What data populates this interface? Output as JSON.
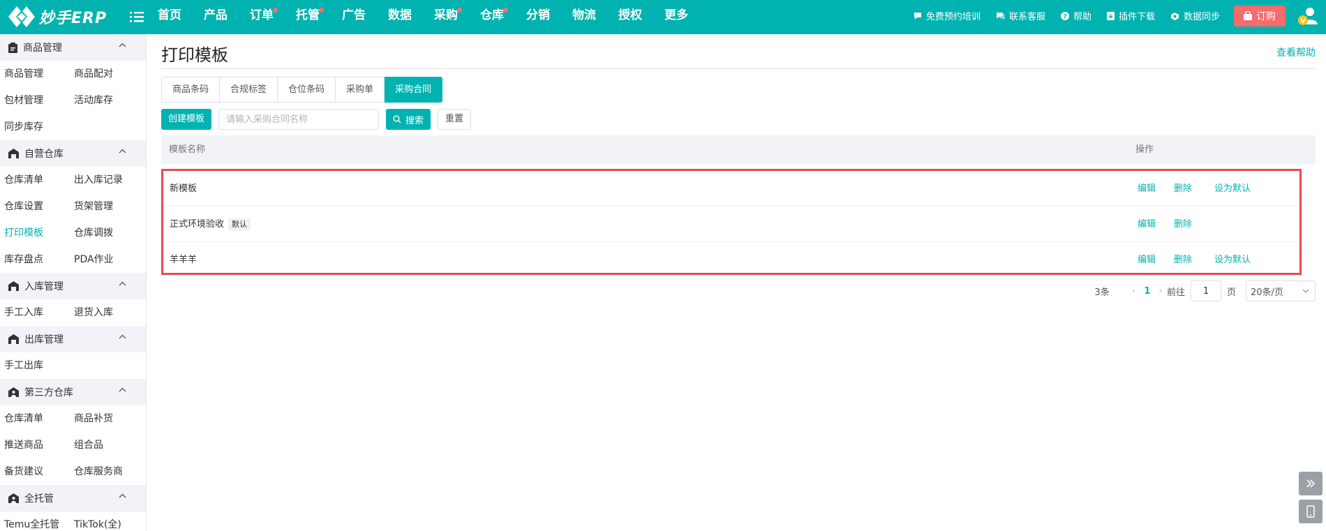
{
  "app": {
    "logo_text": "妙手ERP"
  },
  "nav": {
    "items": [
      {
        "label": "首页",
        "dot": false
      },
      {
        "label": "产品",
        "dot": false
      },
      {
        "label": "订单",
        "dot": true
      },
      {
        "label": "托管",
        "dot": true
      },
      {
        "label": "广告",
        "dot": false
      },
      {
        "label": "数据",
        "dot": false
      },
      {
        "label": "采购",
        "dot": true
      },
      {
        "label": "仓库",
        "dot": true
      },
      {
        "label": "分销",
        "dot": false
      },
      {
        "label": "物流",
        "dot": false
      },
      {
        "label": "授权",
        "dot": false
      },
      {
        "label": "更多",
        "dot": false
      }
    ],
    "tools": {
      "training": "免费预约培训",
      "service": "联系客服",
      "help": "帮助",
      "plugin": "插件下载",
      "sync": "数据同步"
    },
    "subscribe": "订购"
  },
  "sidebar": {
    "groups": [
      {
        "title": "商品管理",
        "icon": "clipboard-icon",
        "links": [
          "商品管理",
          "商品配对",
          "包材管理",
          "活动库存",
          "同步库存"
        ]
      },
      {
        "title": "自营仓库",
        "icon": "warehouse-icon",
        "links": [
          "仓库清单",
          "出入库记录",
          "仓库设置",
          "货架管理",
          "打印模板",
          "仓库调拨",
          "库存盘点",
          "PDA作业"
        ]
      },
      {
        "title": "入库管理",
        "icon": "warehouse-icon",
        "links": [
          "手工入库",
          "退货入库"
        ]
      },
      {
        "title": "出库管理",
        "icon": "warehouse-icon",
        "links": [
          "手工出库"
        ]
      },
      {
        "title": "第三方仓库",
        "icon": "warehouse-person-icon",
        "links": [
          "仓库清单",
          "商品补货",
          "推送商品",
          "组合品",
          "备货建议",
          "仓库服务商"
        ]
      },
      {
        "title": "全托管",
        "icon": "warehouse-person-icon",
        "links": [
          "Temu全托管",
          "TikTok(全)"
        ]
      }
    ],
    "active_link": "打印模板"
  },
  "main": {
    "title": "打印模板",
    "help_link": "查看帮助",
    "tabs": [
      "商品条码",
      "合规标签",
      "仓位条码",
      "采购单",
      "采购合同"
    ],
    "active_tab": 4,
    "toolbar": {
      "create": "创建模板",
      "search_placeholder": "请输入采购合同名称",
      "search": "搜索",
      "reset": "重置"
    },
    "table": {
      "columns": {
        "name": "模板名称",
        "ops": "操作"
      },
      "rows": [
        {
          "name": "新模板",
          "badge": "",
          "ops": [
            "编辑",
            "删除",
            "设为默认"
          ]
        },
        {
          "name": "正式环境验收",
          "badge": "默认",
          "ops": [
            "编辑",
            "删除"
          ]
        },
        {
          "name": "羊羊羊",
          "badge": "",
          "ops": [
            "编辑",
            "删除",
            "设为默认"
          ]
        }
      ]
    },
    "pager": {
      "total": "3条",
      "current": "1",
      "goto_label": "前往",
      "goto_value": "1",
      "page_unit": "页",
      "page_size": "20条/页"
    }
  },
  "colors": {
    "accent": "#00b3b0",
    "highlight": "#e84a55",
    "subscribe": "#f56c6c"
  }
}
